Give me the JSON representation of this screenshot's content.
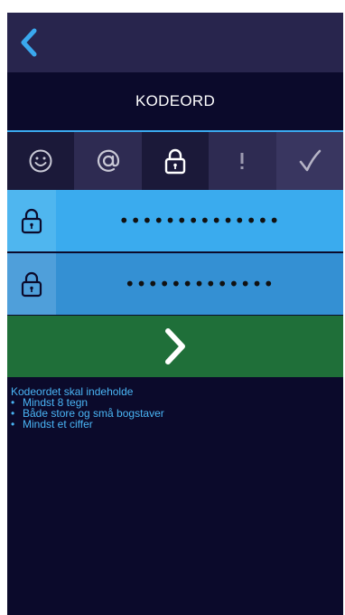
{
  "header": {
    "back_icon": "chevron-left-icon",
    "title": "KODEORD"
  },
  "steps": [
    {
      "icon": "smiley-icon",
      "label": "☺"
    },
    {
      "icon": "at-icon",
      "label": "@"
    },
    {
      "icon": "lock-icon",
      "label": ""
    },
    {
      "icon": "exclamation-icon",
      "label": "!"
    },
    {
      "icon": "checkmark-icon",
      "label": "✓"
    }
  ],
  "fields": {
    "password": {
      "value": "••••••••••••••",
      "icon": "lock-icon"
    },
    "confirm": {
      "value": "•••••••••••••",
      "icon": "lock-icon"
    }
  },
  "next": {
    "icon": "chevron-right-icon"
  },
  "hints": {
    "heading": "Kodeordet skal indeholde",
    "items": [
      "Mindst 8 tegn",
      "Både store og små bogstaver",
      "Mindst et ciffer"
    ]
  },
  "colors": {
    "background": "#0b0a2b",
    "accent": "#3aa8ee",
    "next_green": "#1f6f39"
  }
}
